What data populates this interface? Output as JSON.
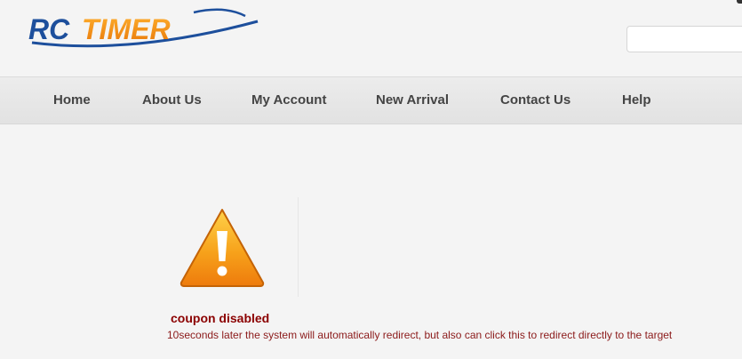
{
  "header": {
    "logo_text": "RCTIMER",
    "search": {
      "placeholder": "",
      "value": ""
    }
  },
  "nav": {
    "items": [
      {
        "label": "Home"
      },
      {
        "label": "About Us"
      },
      {
        "label": "My Account"
      },
      {
        "label": "New Arrival"
      },
      {
        "label": "Contact Us"
      },
      {
        "label": "Help"
      }
    ]
  },
  "alert": {
    "icon": "warning-icon",
    "title": "coupon disabled",
    "message": "10seconds later the system will automatically redirect, but also can click this to redirect directly to the target"
  },
  "colors": {
    "logo_blue": "#1d4f9c",
    "logo_orange": "#f28c0f",
    "nav_text": "#444444",
    "alert_red": "#8b0000",
    "warning_orange": "#f7a21b"
  }
}
